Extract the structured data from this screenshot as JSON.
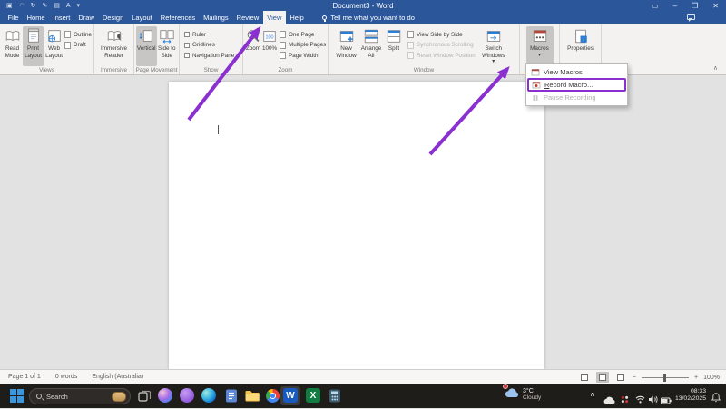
{
  "window": {
    "title": "Document3 - Word"
  },
  "icons": {
    "ribbon_options": "▭",
    "minimize": "–",
    "restore": "❐",
    "close": "✕",
    "dropdown": "▾",
    "collapse_ribbon": "∧",
    "tray_expand": "∧",
    "qat": [
      "▣",
      "↶",
      "↻",
      "✎",
      "▤",
      "A",
      "▾"
    ]
  },
  "tabs": {
    "items": [
      "File",
      "Home",
      "Insert",
      "Draw",
      "Design",
      "Layout",
      "References",
      "Mailings",
      "Review",
      "View",
      "Help"
    ],
    "active": "View",
    "tell_me": "Tell me what you want to do"
  },
  "ribbon": {
    "views": {
      "label": "Views",
      "read_mode": "Read Mode",
      "print_layout": "Print Layout",
      "web_layout": "Web Layout",
      "outline": "Outline",
      "draft": "Draft"
    },
    "immersive": {
      "label": "Immersive",
      "reader": "Immersive Reader"
    },
    "page_movement": {
      "label": "Page Movement",
      "vertical": "Vertical",
      "side_to_side": "Side to Side"
    },
    "show": {
      "label": "Show",
      "ruler": "Ruler",
      "gridlines": "Gridlines",
      "navigation_pane": "Navigation Pane"
    },
    "zoom": {
      "label": "Zoom",
      "zoom": "Zoom",
      "percent": "100%",
      "one_page": "One Page",
      "multiple_pages": "Multiple Pages",
      "page_width": "Page Width"
    },
    "window": {
      "label": "Window",
      "new_window": "New Window",
      "arrange_all": "Arrange All",
      "split": "Split",
      "view_side_by_side": "View Side by Side",
      "synchronous_scrolling": "Synchronous Scrolling",
      "reset_window_position": "Reset Window Position",
      "switch_windows": "Switch Windows"
    },
    "macros": {
      "button": "Macros"
    },
    "properties": {
      "button": "Properties"
    }
  },
  "macros_menu": {
    "view_macros": "View Macros",
    "record_macro": "Record Macro...",
    "pause_recording": "Pause Recording"
  },
  "statusbar": {
    "page": "Page 1 of 1",
    "words": "0 words",
    "language": "English (Australia)",
    "zoom_out": "−",
    "zoom_in": "+",
    "zoom_level": "100%"
  },
  "taskbar": {
    "search": "Search",
    "weather": {
      "temp": "3°C",
      "condition": "Cloudy"
    },
    "clock": {
      "time": "08:33",
      "date": "13/02/2025"
    }
  },
  "annotations": {
    "color": "#8a30d0",
    "arrow1_target": "View tab",
    "arrow2_target": "Macros button",
    "box_target": "Record Macro..."
  },
  "colors": {
    "titlebar": "#2b579a",
    "ribbon_bg": "#f3f2f1",
    "selected_button": "#c8c6c4",
    "annotation": "#8a30d0"
  }
}
